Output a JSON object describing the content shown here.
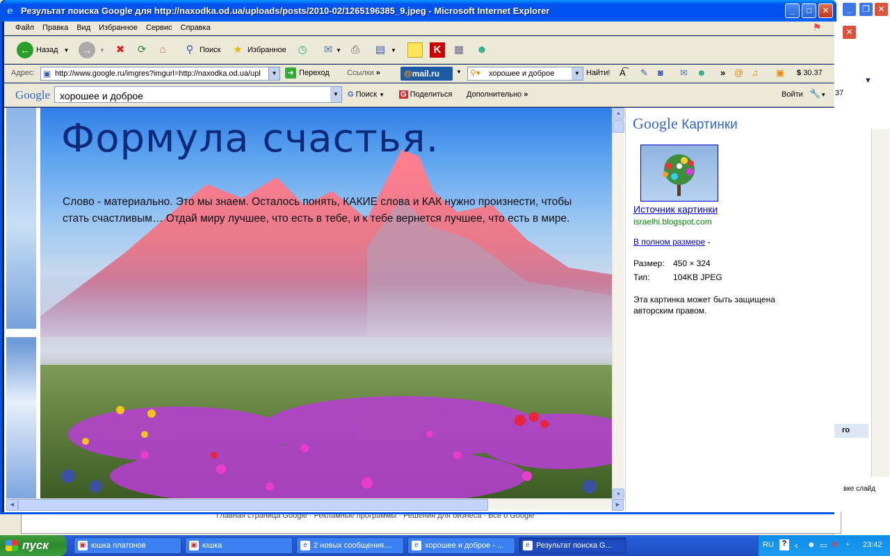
{
  "window": {
    "title": "Результат поиска Google для http://naxodka.od.ua/uploads/posts/2010-02/1265196385_9.jpeg - Microsoft Internet Explorer"
  },
  "menu": [
    "Файл",
    "Правка",
    "Вид",
    "Избранное",
    "Сервис",
    "Справка"
  ],
  "toolbar": {
    "back": "Назад",
    "search": "Поиск",
    "favorites": "Избранное"
  },
  "address": {
    "label": "Адрес:",
    "url": "http://www.google.ru/imgres?imgurl=http://naxodka.od.ua/upl",
    "go": "Переход",
    "links": "Ссылки"
  },
  "mailru": {
    "logo_at": "@",
    "logo_text": "mail.ru",
    "query": "хорошее и доброе",
    "find": "Найти!",
    "money": "30.37",
    "money_prefix": "$"
  },
  "google_toolbar": {
    "logo": "Google",
    "query": "хорошее и доброе",
    "search": "Поиск",
    "share": "Поделиться",
    "more": "Дополнительно",
    "login": "Войти"
  },
  "hero": {
    "title": "Формула счастья.",
    "text": "Слово - материально. Это мы знаем. Осталось понять, КАКИЕ слова и КАК нужно произнести, чтобы стать счастливым… Отдай миру лучшее, что есть в тебе, и к тебе вернется лучшее, что есть в мире."
  },
  "panel": {
    "logo": "Google",
    "logo_sub": "Картинки",
    "source_link": "Источник картинки",
    "domain": "israelhi.blogspot.com",
    "full_size": "В полном размере",
    "full_size_suffix": " -",
    "size_label": "Размер:",
    "size_value": "450 × 324",
    "type_label": "Тип:",
    "type_value": "104KB JPEG",
    "copyright": "Эта картинка может быть защищена авторским правом."
  },
  "background_window": {
    "bottom_text": "Главная страница Google · Рекламные программы · Решения для бизнеса · Всё о Google",
    "right_text_1": "37",
    "right_text_2": "го",
    "right_text_3": "вке слайд"
  },
  "taskbar": {
    "start": "пуск",
    "tasks": [
      "юшка платонов",
      "юшка",
      "2 новых сообщения....",
      "хорошее и доброе - ...",
      "Результат поиска G..."
    ],
    "lang": "RU",
    "clock": "23:42"
  },
  "colors": {
    "titlebar": "#0053ee",
    "taskbar": "#245edb",
    "start": "#3c9a3c",
    "link": "#0000cc",
    "domain": "#008800",
    "hero_title": "#0e2a78"
  }
}
